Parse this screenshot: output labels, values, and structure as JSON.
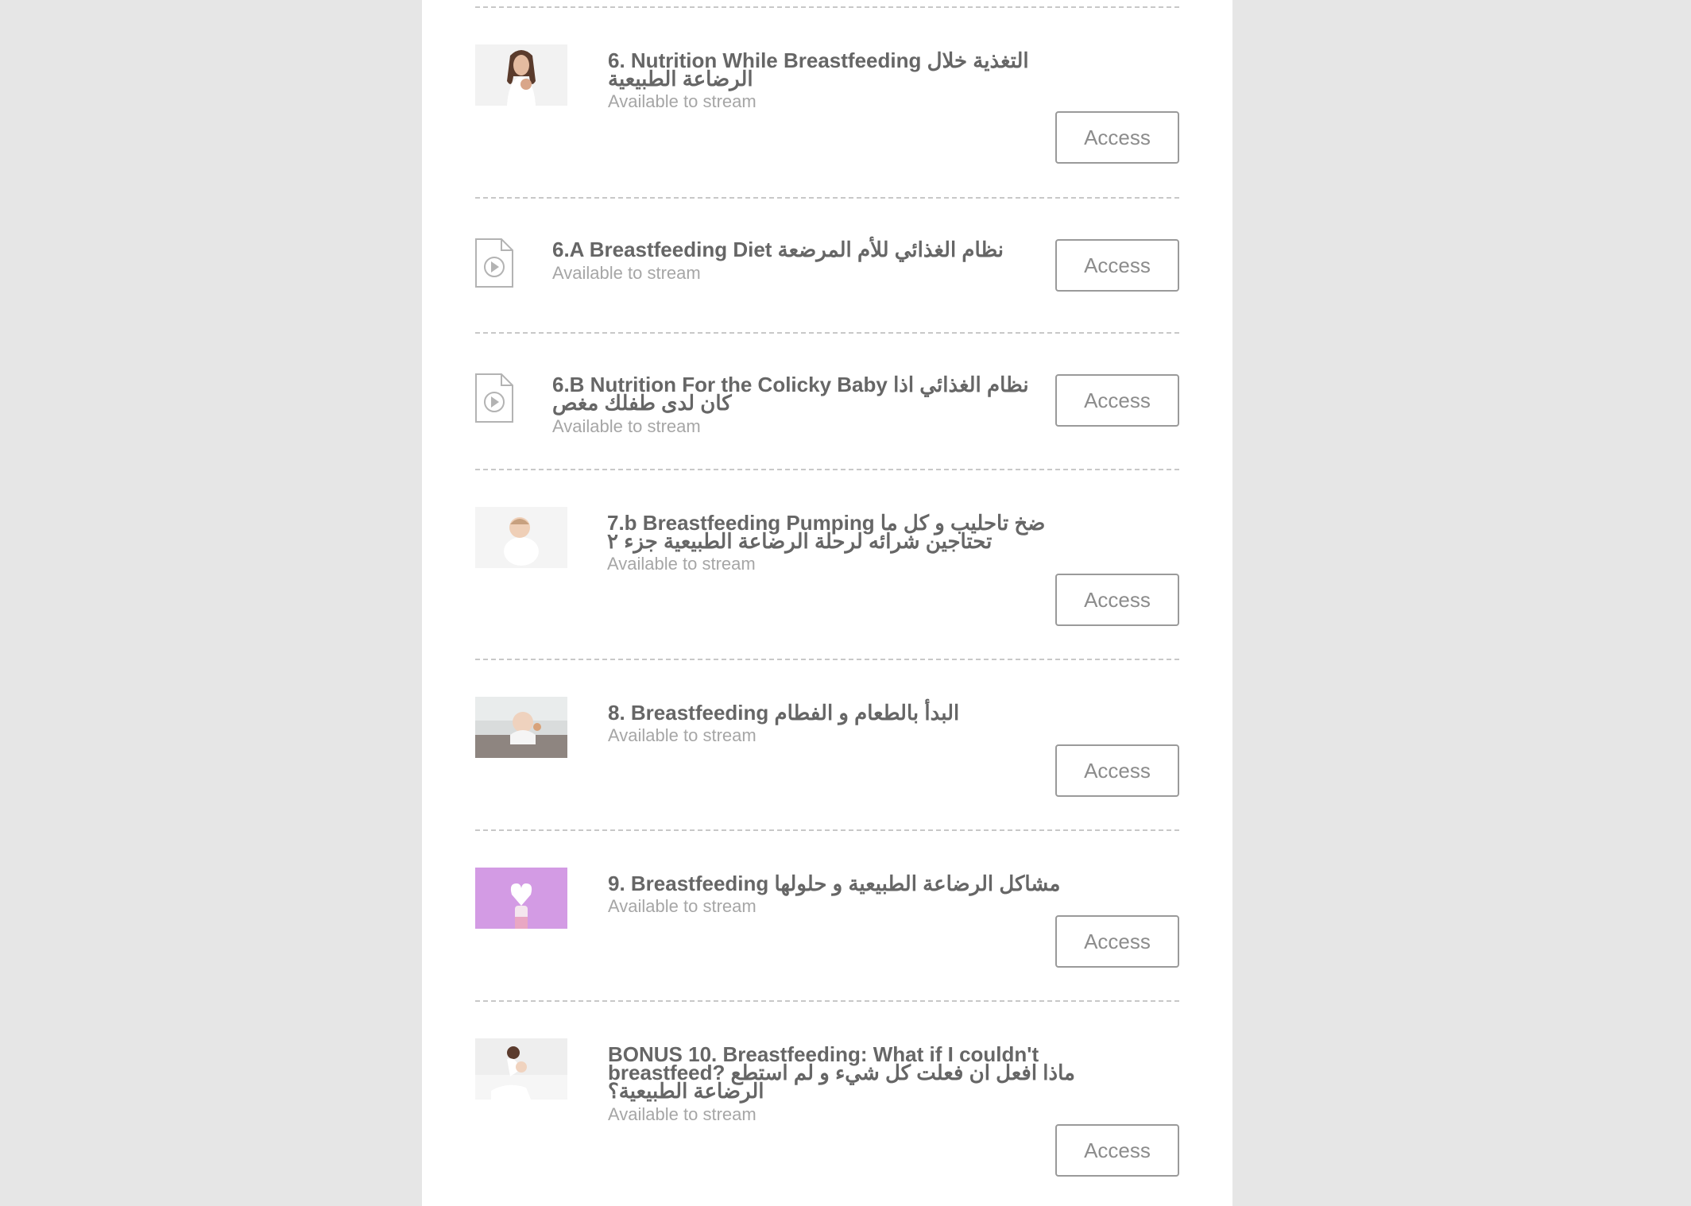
{
  "lessons": [
    {
      "title": "6. Nutrition While Breastfeeding التغذية خلال الرضاعة الطبيعية",
      "status": "Available to stream",
      "action": "Access",
      "media": "photo-woman-eating"
    },
    {
      "title": "6.A Breastfeeding Diet نظام الغذائي للأم المرضعة",
      "status": "Available to stream",
      "action": "Access",
      "media": "video-file-icon"
    },
    {
      "title": "6.B Nutrition For the Colicky Baby نظام الغذائي اذا كان لدى طفلك مغص",
      "status": "Available to stream",
      "action": "Access",
      "media": "video-file-icon"
    },
    {
      "title": "7.b Breastfeeding Pumping ضخ تاحليب و كل ما تحتاجين شرائه لرحلة الرضاعة الطبيعية جزء ٢",
      "status": "Available to stream",
      "action": "Access",
      "media": "photo-baby-lying"
    },
    {
      "title": "8. Breastfeeding البدأ بالطعام و الفطام",
      "status": "Available to stream",
      "action": "Access",
      "media": "photo-baby-eating"
    },
    {
      "title": "9. Breastfeeding مشاكل الرضاعة الطبيعية و حلولها",
      "status": "Available to stream",
      "action": "Access",
      "media": "photo-milk-bottle-heart"
    },
    {
      "title": "BONUS 10. Breastfeeding: What if I couldn't breastfeed? ماذا افعل ان فعلت كل شيء و لم استطع الرضاعة الطبيعية؟",
      "status": "Available to stream",
      "action": "Access",
      "media": "photo-mother-holding-baby"
    }
  ],
  "colors": {
    "background": "#e6e6e6",
    "panel": "#ffffff",
    "title_text": "#666666",
    "status_text": "#a6a6a6",
    "button_border": "#9a9a9a"
  }
}
